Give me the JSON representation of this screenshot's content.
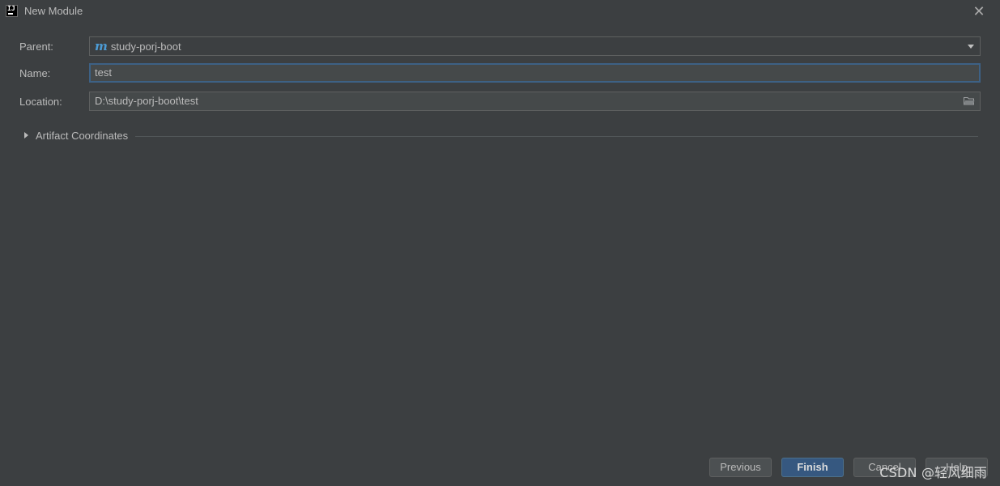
{
  "window": {
    "title": "New Module",
    "app_icon": "intellij-idea-icon",
    "close_icon": "close-icon"
  },
  "form": {
    "parent_label": "Parent:",
    "parent_value": "study-porj-boot",
    "parent_icon": "maven-m-icon",
    "name_label": "Name:",
    "name_value": "test",
    "location_label": "Location:",
    "location_value": "D:\\study-porj-boot\\test",
    "location_icon": "folder-icon"
  },
  "section": {
    "artifact_label": "Artifact Coordinates",
    "expanded": false
  },
  "buttons": {
    "previous": "Previous",
    "finish": "Finish",
    "cancel": "Cancel",
    "help": "Help"
  },
  "watermark": "CSDN @轻风细雨",
  "colors": {
    "background": "#3c3f41",
    "field": "#45494a",
    "focus_border": "#3d6185",
    "primary_button": "#365880",
    "maven_icon": "#4c9cd6"
  }
}
